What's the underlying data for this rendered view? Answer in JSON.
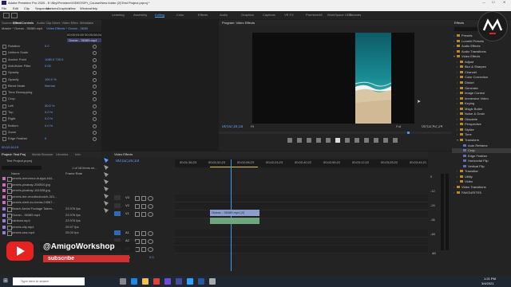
{
  "title_bar": {
    "title": "Adobe Premiere Pro 2020 - E:\\Sky\\Premiere\\VIDEOS\\Pr_Course\\New folder (2)\\Test Project.prproj *"
  },
  "menu": [
    "File",
    "Edit",
    "Clip",
    "Sequence",
    "Markers",
    "Graphics",
    "View",
    "Window",
    "Help"
  ],
  "workspaces": [
    "Learning",
    "Assembly",
    "Editing",
    "Color",
    "Effects",
    "Audio",
    "Graphics",
    "Captions",
    "VR FX",
    "Premiere4K",
    "WorkSpace 1920",
    "Tutorials"
  ],
  "active_workspace": "Editing",
  "source_tabs": [
    "Source: (no clips)",
    "Effect Controls",
    "Audio Clip Mixer: Video Effects",
    "Metadata"
  ],
  "effect_controls": {
    "clip_path": "Master * Ocean - 36389.mp4",
    "seq_path": "Video Effects * Ocean - 36389...",
    "ruler": [
      "00;00;04;00",
      "00;00;08;04",
      "00;00;12;04"
    ],
    "clip_label": "Ocean - 36389.mp4",
    "rows": [
      {
        "label": "Rotation",
        "value": "0.0"
      },
      {
        "label": "Uniform Scale",
        "value": ""
      },
      {
        "label": "Anchor Point",
        "value": "1080.0   720.0"
      },
      {
        "label": "Anti-flicker Filter",
        "value": "0.00"
      },
      {
        "label": "Opacity",
        "value": ""
      },
      {
        "label": "Opacity",
        "value": "100.0 %"
      },
      {
        "label": "Blend Mode",
        "value": "Normal"
      },
      {
        "label": "Time Remapping",
        "value": ""
      },
      {
        "label": "Crop",
        "value": ""
      },
      {
        "label": "Left",
        "value": "30.0 %"
      },
      {
        "label": "Top",
        "value": "0.0 %"
      },
      {
        "label": "Right",
        "value": "0.0 %"
      },
      {
        "label": "Bottom",
        "value": "0.0 %"
      },
      {
        "label": "Zoom",
        "value": ""
      },
      {
        "label": "Edge Feather",
        "value": "0"
      }
    ],
    "timecode": "00;02;16;19"
  },
  "program": {
    "tab": "Program: Video Effects",
    "timecode": "00;02;16;19",
    "fit": "Fit",
    "quality": "Full",
    "duration": "00;02;42;24"
  },
  "project": {
    "tabs": [
      "Project: Test Project",
      "Media Browser",
      "Libraries",
      "Info"
    ],
    "file": "Test Project.prproj",
    "count": "1 of 18 items se...",
    "search_placeholder": "",
    "columns": [
      "Name",
      "Frame Rate"
    ],
    "items": [
      {
        "name": "pexels-mervenur-bulgut-464...",
        "rate": "",
        "color": "#c56fbf"
      },
      {
        "name": "pexels-pixabay-258510.jpg",
        "rate": "",
        "color": "#c56fbf"
      },
      {
        "name": "pexels-pixabay-161028.jpg",
        "rate": "",
        "color": "#c56fbf"
      },
      {
        "name": "pexels-ibrr-mouttouloutch-321...",
        "rate": "",
        "color": "#c56fbf"
      },
      {
        "name": "pexels-nimit-ku-ineda-24567...",
        "rate": "",
        "color": "#c56fbf"
      },
      {
        "name": "Beach Aerial Footage Taken...",
        "rate": "23.976 fps",
        "color": "#9a7bd8"
      },
      {
        "name": "Ocean - 36389.mp4",
        "rate": "23.976 fps",
        "color": "#9a7bd8"
      },
      {
        "name": "rainbow.mp4",
        "rate": "23.976 fps",
        "color": "#9a7bd8"
      },
      {
        "name": "pexels-city.mp4",
        "rate": "29.97 fps",
        "color": "#9a7bd8"
      },
      {
        "name": "pexels-sea.mp4",
        "rate": "25.00 fps",
        "color": "#9a7bd8"
      }
    ]
  },
  "timeline": {
    "tab": "Video Effects",
    "timecode": "00;02;16;19",
    "ruler": [
      "00;01;36;23",
      "00;01;52;23",
      "00;02;08;23",
      "00;02;24;23",
      "00;02;40;22",
      "00;02;56;22",
      "00;03;12;22",
      "00;03;28;22",
      "00;03;44;21"
    ],
    "tracks": [
      "V3",
      "V2",
      "V1",
      "A1",
      "A2",
      "A3"
    ],
    "mix_label": "Mix",
    "mix_value": "0.0",
    "clip_v": "Ocean - 36389.mp4 [V]",
    "clip_a": "",
    "levels": [
      "0",
      "-12",
      "-24",
      "-36",
      "-48"
    ],
    "level_units": "dB"
  },
  "effects": {
    "tab": "Effects",
    "items": [
      {
        "label": "Presets",
        "indent": 1,
        "open": false
      },
      {
        "label": "Lumetri Presets",
        "indent": 1,
        "open": false
      },
      {
        "label": "Audio Effects",
        "indent": 1,
        "open": false
      },
      {
        "label": "Audio Transitions",
        "indent": 1,
        "open": false
      },
      {
        "label": "Video Effects",
        "indent": 1,
        "open": true
      },
      {
        "label": "Adjust",
        "indent": 2,
        "open": false
      },
      {
        "label": "Blur & Sharpen",
        "indent": 2,
        "open": false
      },
      {
        "label": "Channel",
        "indent": 2,
        "open": false
      },
      {
        "label": "Color Correction",
        "indent": 2,
        "open": false
      },
      {
        "label": "Distort",
        "indent": 2,
        "open": false
      },
      {
        "label": "Generate",
        "indent": 2,
        "open": false
      },
      {
        "label": "Image Control",
        "indent": 2,
        "open": false
      },
      {
        "label": "Immersive Video",
        "indent": 2,
        "open": false
      },
      {
        "label": "Keying",
        "indent": 2,
        "open": false
      },
      {
        "label": "Magic Bullet",
        "indent": 2,
        "open": false
      },
      {
        "label": "Noise & Grain",
        "indent": 2,
        "open": false
      },
      {
        "label": "Obsolete",
        "indent": 2,
        "open": false
      },
      {
        "label": "Perspective",
        "indent": 2,
        "open": false
      },
      {
        "label": "Stylize",
        "indent": 2,
        "open": false
      },
      {
        "label": "Time",
        "indent": 2,
        "open": false
      },
      {
        "label": "Transform",
        "indent": 2,
        "open": true
      },
      {
        "label": "Auto Reframe",
        "indent": 3,
        "open": false
      },
      {
        "label": "Crop",
        "indent": 3,
        "open": false
      },
      {
        "label": "Edge Feather",
        "indent": 3,
        "open": false
      },
      {
        "label": "Horizontal Flip",
        "indent": 3,
        "open": false
      },
      {
        "label": "Vertical Flip",
        "indent": 3,
        "open": false
      },
      {
        "label": "Transition",
        "indent": 2,
        "open": false
      },
      {
        "label": "Utility",
        "indent": 2,
        "open": false
      },
      {
        "label": "Video",
        "indent": 2,
        "open": false
      },
      {
        "label": "Video Transitions",
        "indent": 1,
        "open": false
      },
      {
        "label": "FAVOURITES",
        "indent": 1,
        "open": false
      }
    ],
    "selected": "Crop"
  },
  "brand": {
    "handle": "@AmigoWorkshop",
    "subscribe": "subscribe"
  },
  "taskbar": {
    "search_placeholder": "Type here to search",
    "time": "1:21 PM",
    "date": "3/4/2021"
  },
  "colors": {
    "accent": "#2d8ceb",
    "playhead": "#3d9bf2",
    "clip_v": "#8a9fcd",
    "clip_a": "#6fa57c"
  }
}
